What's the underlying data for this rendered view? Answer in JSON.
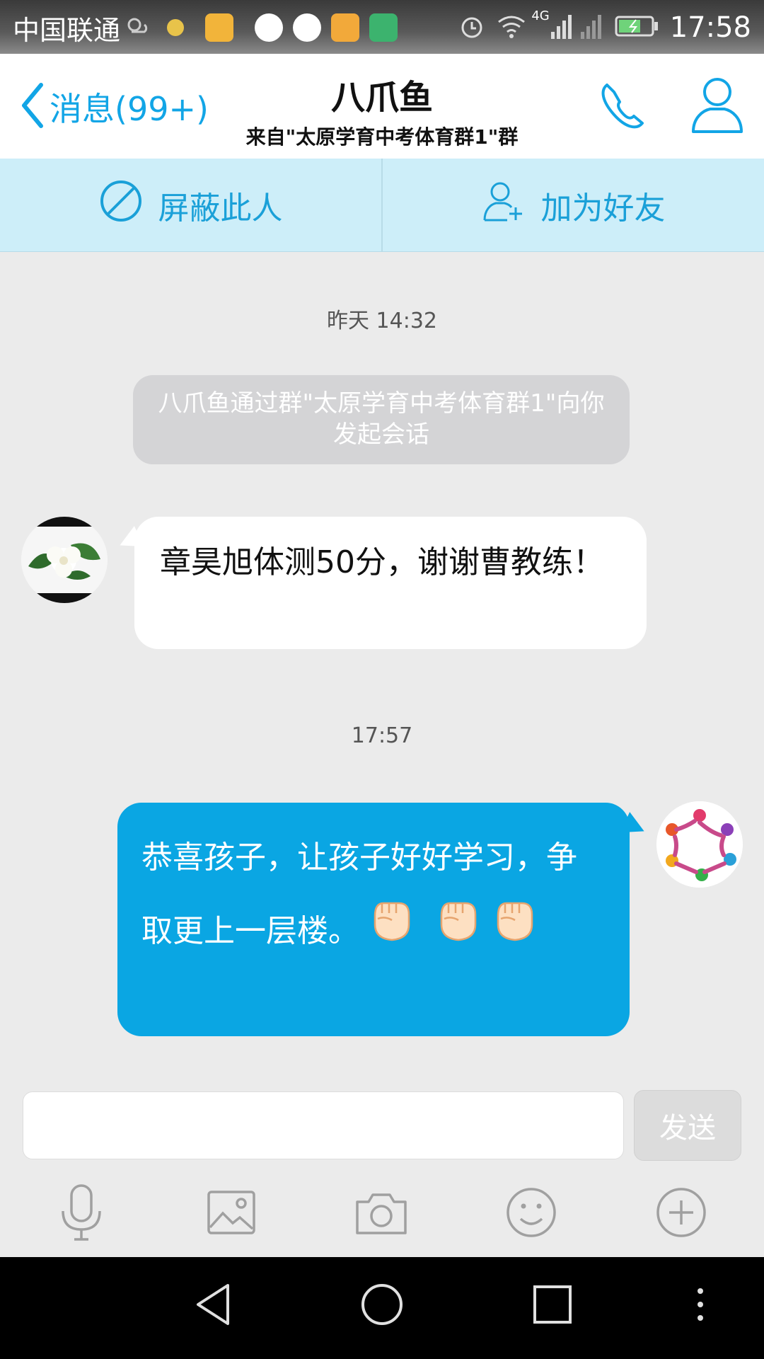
{
  "status_bar": {
    "carrier": "中国联通",
    "network": "4G",
    "time": "17:58",
    "icons": [
      "weather-icon",
      "notification-dot-icon",
      "app-icon",
      "browser-icon",
      "browser-icon",
      "app-icon",
      "pdf-app-icon",
      "alarm-icon",
      "wifi-icon",
      "signal-icon",
      "signal-icon",
      "battery-icon"
    ]
  },
  "header": {
    "back_label": "消息(99+)",
    "title": "八爪鱼",
    "subtitle": "来自\"太原学育中考体育群1\"群",
    "accent_color": "#12a5e6"
  },
  "actions": {
    "block_label": "屏蔽此人",
    "add_friend_label": "加为好友"
  },
  "chat": {
    "timestamp_1": "昨天 14:32",
    "system_message": "八爪鱼通过群\"太原学育中考体育群1\"向你发起会话",
    "incoming_message": "章昊旭体测50分，谢谢曹教练！",
    "timestamp_2": "17:57",
    "outgoing_message": "恭喜孩子，让孩子好好学习，争取更上一层楼。",
    "outgoing_emoji": [
      "fist-emoji",
      "fist-emoji",
      "fist-emoji"
    ],
    "outgoing_color": "#0aa6e3"
  },
  "input": {
    "value": "",
    "placeholder": "",
    "send_label": "发送"
  },
  "toolbar": [
    "microphone-icon",
    "image-icon",
    "camera-icon",
    "emoji-icon",
    "plus-icon"
  ]
}
